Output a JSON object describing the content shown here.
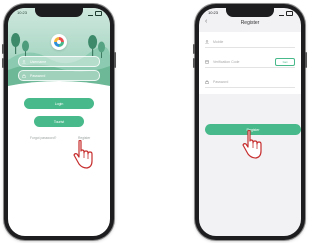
{
  "login": {
    "status_time": "10:23",
    "username_placeholder": "Username",
    "password_placeholder": "Password",
    "login_button": "Login",
    "tourist_button": "Tourist",
    "forgot_link": "Forgot password?",
    "register_link": "Register"
  },
  "register": {
    "status_time": "10:23",
    "title": "Register",
    "back_glyph": "‹",
    "phone_placeholder": "Mobile",
    "code_placeholder": "Verification Code",
    "send_button": "Get",
    "password_placeholder": "Password",
    "register_button": "Register"
  },
  "colors": {
    "accent": "#48b98a",
    "hero_light": "#cfe8de",
    "hero_dark": "#7fc3a8",
    "phone_body": "#1d1d1f",
    "hand_stroke": "#c62d2d",
    "register_bg": "#f2f2f5"
  },
  "icons": {
    "user_field": "user-icon",
    "lock_field": "lock-icon",
    "pointer": "hand-pointer-icon"
  }
}
